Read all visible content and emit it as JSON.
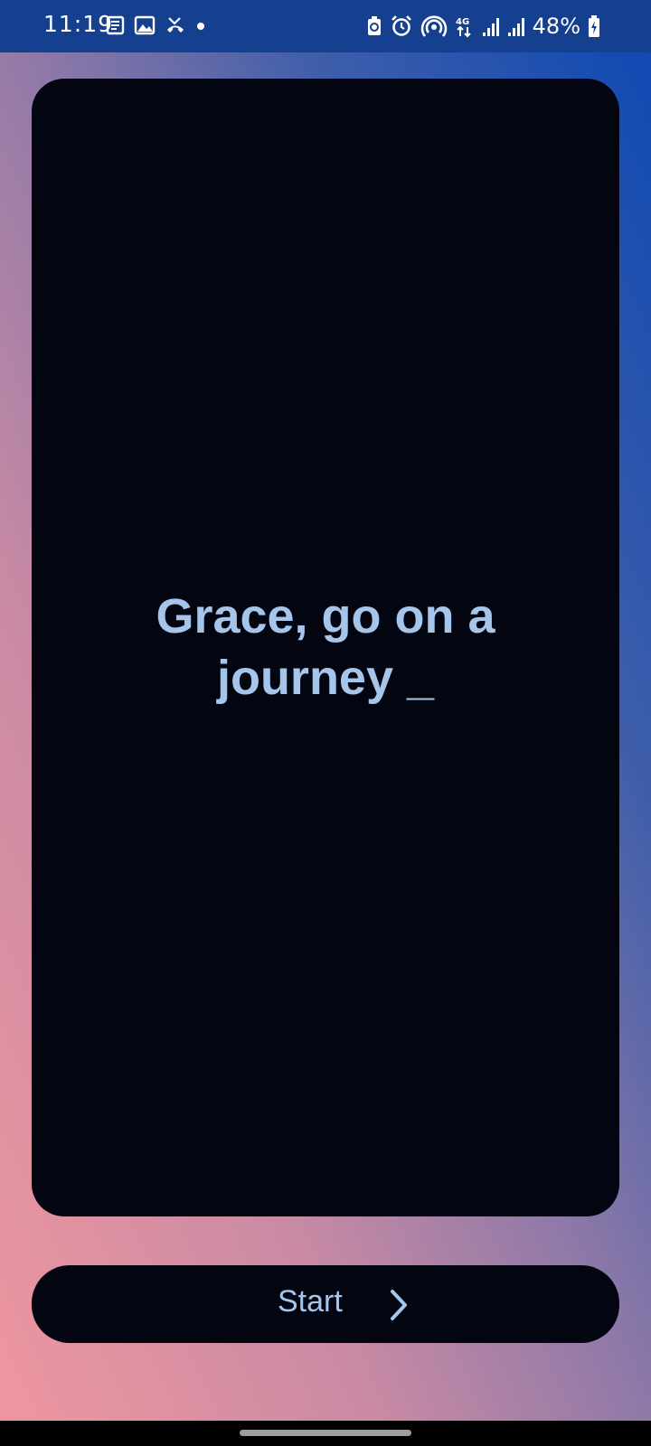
{
  "status_bar": {
    "time": "11:19",
    "battery": "48%",
    "left_icons": [
      "news-icon",
      "image-icon",
      "missed-call-icon",
      "dot-icon"
    ],
    "right_icons": [
      "battery-saver-icon",
      "alarm-icon",
      "hotspot-icon",
      "network-4g-icon",
      "signal-icon",
      "signal-icon",
      "charging-battery-icon"
    ]
  },
  "card": {
    "line1": "Grace, go on a",
    "line2": "journey _"
  },
  "start_button": {
    "label": "Start",
    "icon": "chevron-right-icon"
  },
  "colors": {
    "text": "#a6c5ea",
    "card": "#030611",
    "status_bar": "#153f8f"
  }
}
